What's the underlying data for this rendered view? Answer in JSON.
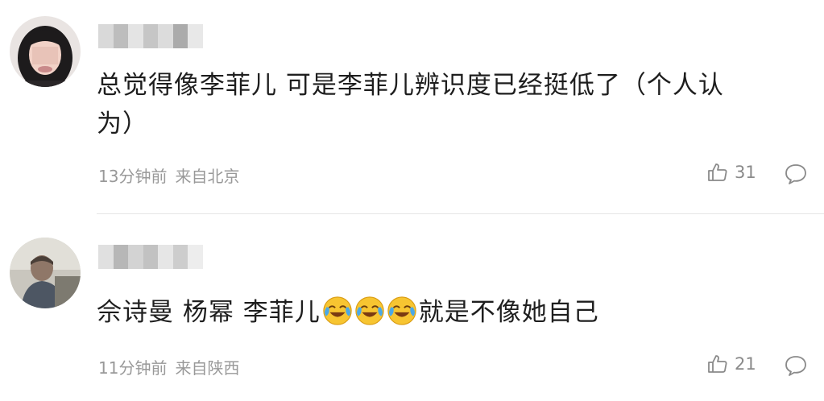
{
  "comments": [
    {
      "text": "总觉得像李菲儿 可是李菲儿辨识度已经挺低了（个人认为）",
      "time": "13分钟前",
      "location": "来自北京",
      "likes": "31"
    },
    {
      "text_before": "佘诗曼 杨幂 李菲儿",
      "emojis": [
        "laugh-cry-emoji",
        "laugh-cry-emoji",
        "laugh-cry-emoji"
      ],
      "text_after": "就是不像她自己",
      "time": "11分钟前",
      "location": "来自陕西",
      "likes": "21"
    }
  ],
  "colors": {
    "text": "#1e1e1e",
    "meta": "#999999",
    "icon": "#8a8a8a",
    "divider": "#e6e6e6"
  },
  "icons": {
    "like": "thumbs-up-icon",
    "reply": "comment-bubble-icon"
  }
}
